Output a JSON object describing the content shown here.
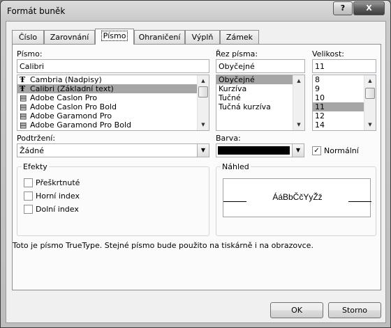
{
  "window": {
    "title": "Formát buněk",
    "help_label": "?",
    "close_label": "X"
  },
  "tabs": [
    "Číslo",
    "Zarovnání",
    "Písmo",
    "Ohraničení",
    "Výplň",
    "Zámek"
  ],
  "font": {
    "label": "Písmo:",
    "value": "Calibri",
    "items": [
      {
        "label": "Cambria (Nadpisy)",
        "icon": "truetype-icon"
      },
      {
        "label": "Calibri (Základní text)",
        "icon": "truetype-icon",
        "selected": true
      },
      {
        "label": "Adobe Caslon Pro",
        "icon": "opentype-icon"
      },
      {
        "label": "Adobe Caslon Pro Bold",
        "icon": "opentype-icon"
      },
      {
        "label": "Adobe Garamond Pro",
        "icon": "opentype-icon"
      },
      {
        "label": "Adobe Garamond Pro Bold",
        "icon": "opentype-icon"
      }
    ]
  },
  "style": {
    "label": "Řez písma:",
    "value": "Obyčejné",
    "items": [
      "Obyčejné",
      "Kurzíva",
      "Tučné",
      "Tučná kurzíva"
    ],
    "selected_index": 0
  },
  "size": {
    "label": "Velikost:",
    "value": "11",
    "items": [
      "8",
      "9",
      "10",
      "11",
      "12",
      "14"
    ],
    "selected_index": 3
  },
  "underline": {
    "label": "Podtržení:",
    "value": "Žádné"
  },
  "color": {
    "label": "Barva:",
    "value": "#000000",
    "normal_label": "Normální",
    "normal_checked": true
  },
  "effects": {
    "label": "Efekty",
    "options": [
      {
        "label": "Přeškrtnuté",
        "checked": false
      },
      {
        "label": "Horní index",
        "checked": false
      },
      {
        "label": "Dolní index",
        "checked": false
      }
    ]
  },
  "preview": {
    "label": "Náhled",
    "sample": "ÁáBbČčYyŽž"
  },
  "info_text": "Toto je písmo TrueType. Stejné písmo bude použito na tiskárně i na obrazovce.",
  "buttons": {
    "ok": "OK",
    "cancel": "Storno"
  }
}
